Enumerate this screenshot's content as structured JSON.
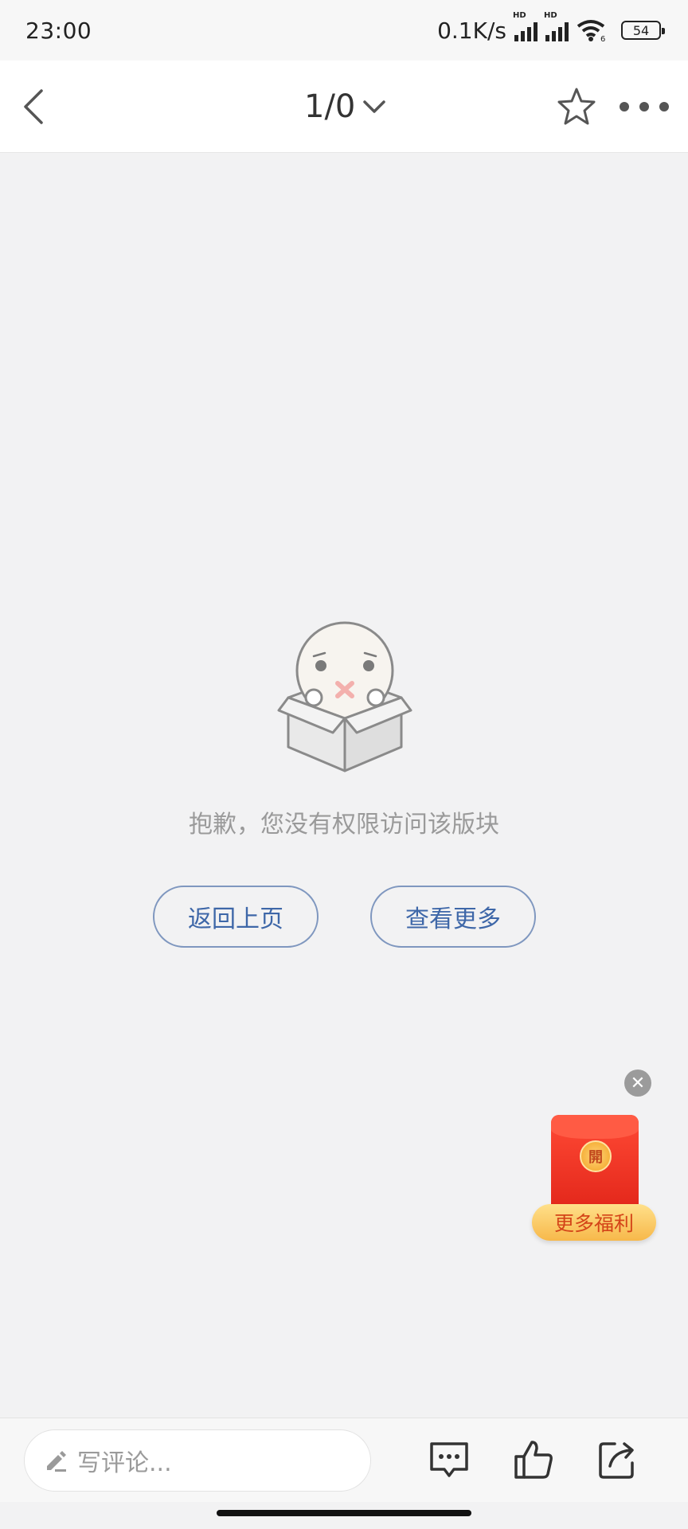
{
  "status_bar": {
    "time": "23:00",
    "net_speed": "0.1K/s",
    "signal_1_label": "HD",
    "signal_2_label": "HD",
    "wifi_label": "6",
    "battery": "54"
  },
  "nav": {
    "page_indicator": "1/0"
  },
  "empty_state": {
    "message": "抱歉，您没有权限访问该版块",
    "back_button": "返回上页",
    "more_button": "查看更多"
  },
  "promo": {
    "coin_text": "開",
    "label": "更多福利",
    "close_symbol": "✕"
  },
  "bottom_bar": {
    "comment_placeholder": "写评论..."
  },
  "colors": {
    "background": "#f2f2f3",
    "accent_blue": "#3e67a8",
    "promo_red": "#e2261a"
  }
}
